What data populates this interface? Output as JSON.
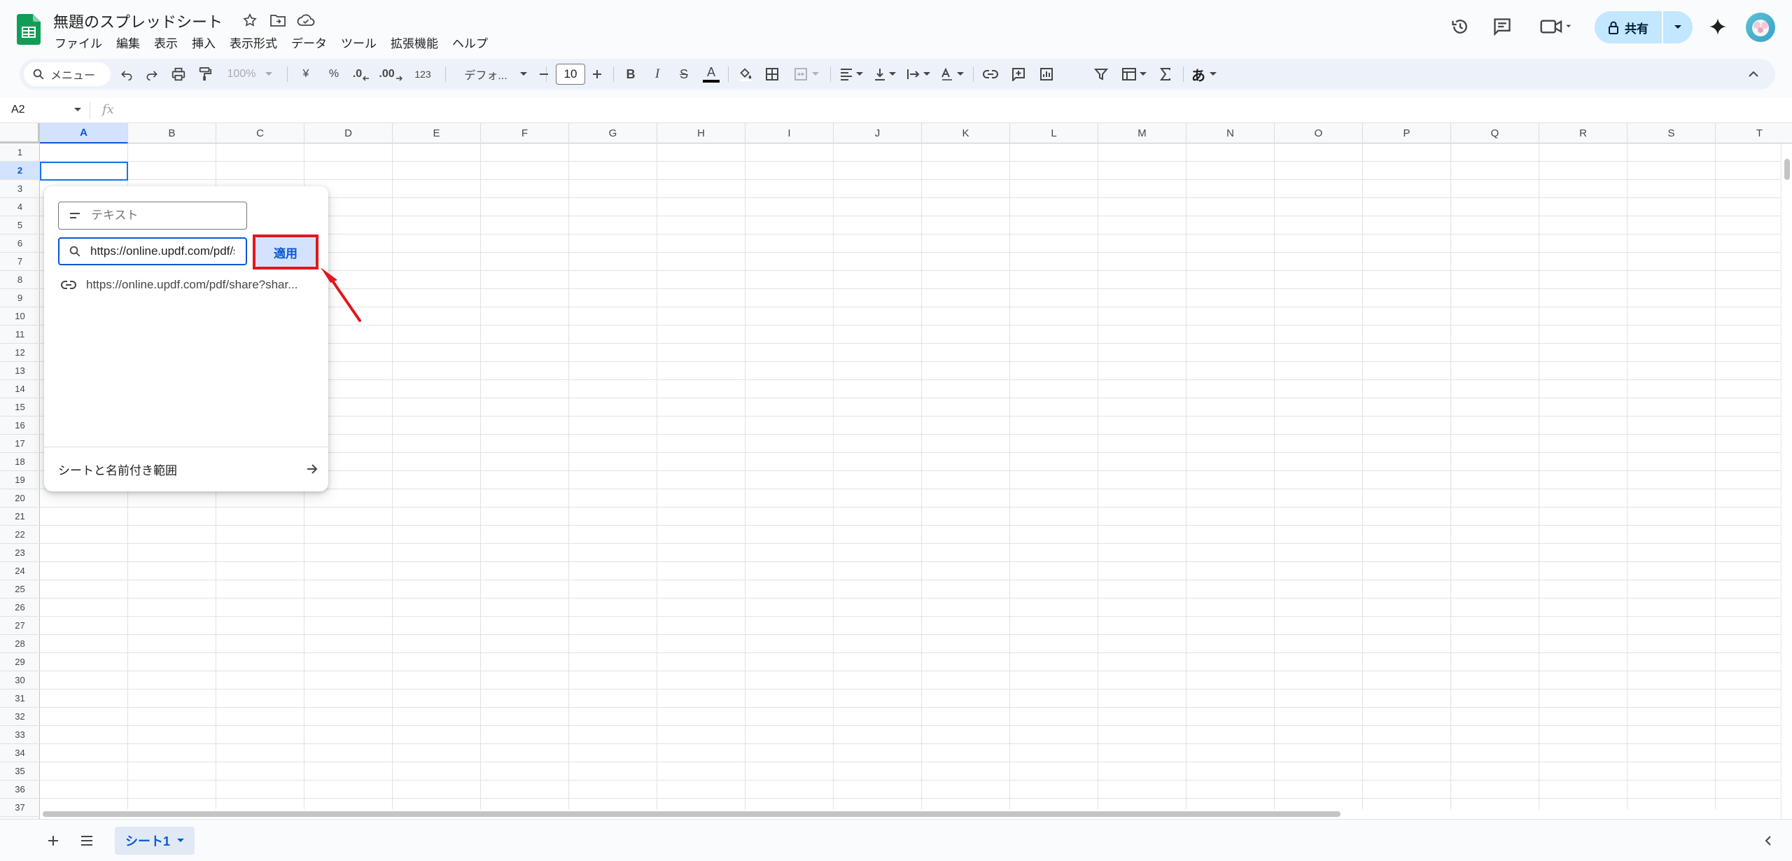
{
  "header": {
    "doc_title": "無題のスプレッドシート",
    "menu": [
      "ファイル",
      "編集",
      "表示",
      "挿入",
      "表示形式",
      "データ",
      "ツール",
      "拡張機能",
      "ヘルプ"
    ],
    "share_label": "共有"
  },
  "toolbar": {
    "search_label": "メニュー",
    "zoom": "100%",
    "currency": "¥",
    "percent": "%",
    "dec_decrease": ".0",
    "dec_increase": ".00",
    "number_format": "123",
    "font_name": "デフォ...",
    "font_size": "10",
    "bold": "B",
    "italic": "I",
    "strike": "S",
    "text_color": "A",
    "ime": "あ"
  },
  "formula_bar": {
    "cell_ref": "A2",
    "fx": "fx"
  },
  "grid": {
    "columns": [
      "A",
      "B",
      "C",
      "D",
      "E",
      "F",
      "G",
      "H",
      "I",
      "J",
      "K",
      "L",
      "M",
      "N",
      "O",
      "P",
      "Q",
      "R",
      "S",
      "T"
    ],
    "active_column": "A",
    "row_count": 37,
    "active_row": 2
  },
  "link_popup": {
    "text_placeholder": "テキスト",
    "url_value": "https://online.updf.com/pdf/share?shar",
    "apply_label": "適用",
    "suggestion": "https://online.updf.com/pdf/share?shar...",
    "sheets_ranges_label": "シートと名前付き範囲"
  },
  "bottom_bar": {
    "sheet_tab": "シート1"
  },
  "colors": {
    "accent": "#0b57d0",
    "highlight_box": "#e4161d",
    "share_bg": "#c2e7ff"
  }
}
